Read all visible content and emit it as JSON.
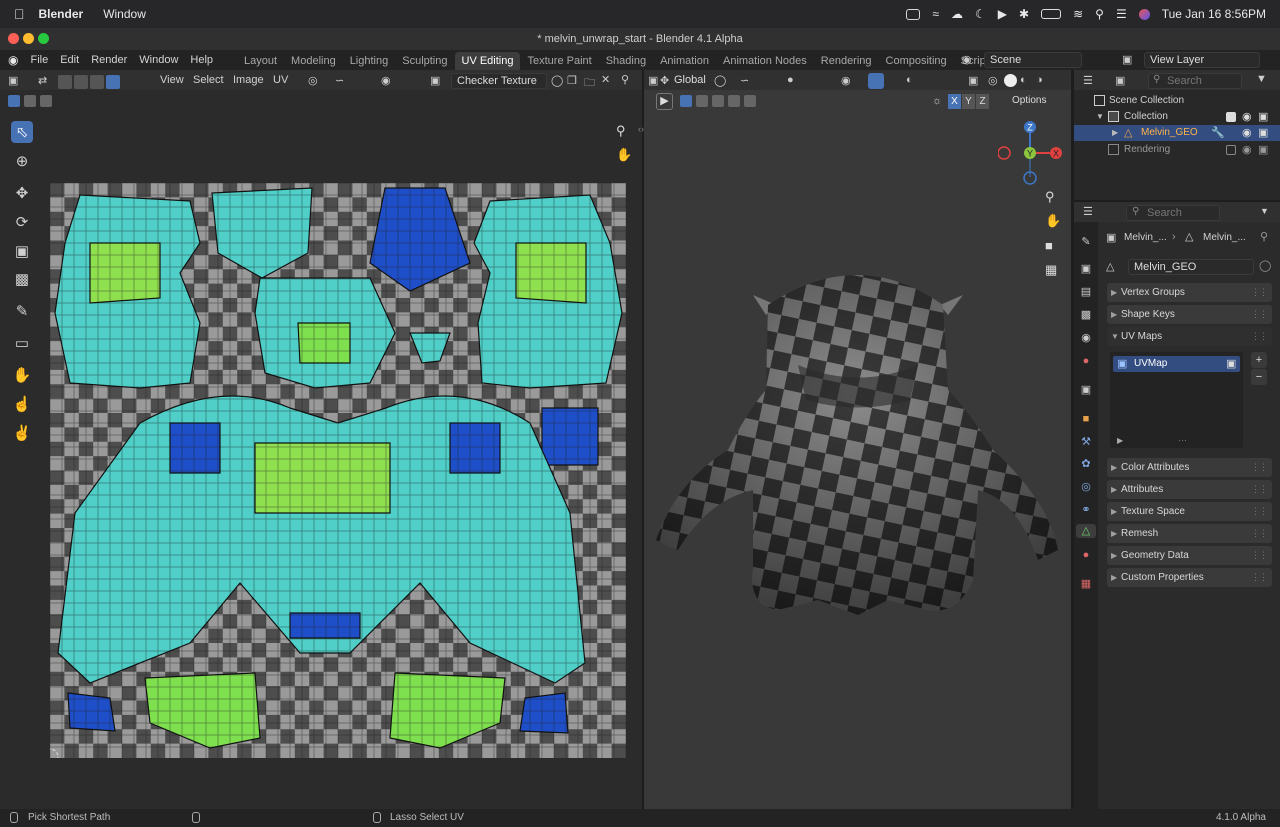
{
  "menubar": {
    "apple_icon": "apple-logo",
    "app_name": "Blender",
    "menus": [
      "Window"
    ],
    "clock": "Tue Jan 16  8:56PM"
  },
  "window": {
    "title": "* melvin_unwrap_start - Blender 4.1 Alpha"
  },
  "topbar": {
    "menus": [
      "File",
      "Edit",
      "Render",
      "Window",
      "Help"
    ],
    "workspaces": [
      "Layout",
      "Modeling",
      "Lighting",
      "Sculpting",
      "UV Editing",
      "Texture Paint",
      "Shading",
      "Animation",
      "Animation Nodes",
      "Rendering",
      "Compositing",
      "Scripting"
    ],
    "active_workspace": "UV Editing",
    "add_tab": "+",
    "scene": "Scene",
    "view_layer": "View Layer"
  },
  "uv_editor": {
    "menus": [
      "View",
      "Select",
      "Image",
      "UV"
    ],
    "image_name": "Checker Texture"
  },
  "viewport": {
    "orientation": "Global",
    "options_label": "Options",
    "axes": {
      "x": "X",
      "y": "Y",
      "z": "Z"
    },
    "gizmo": {
      "z": "Z",
      "y": "Y",
      "x": "X"
    }
  },
  "outliner": {
    "search_placeholder": "Search",
    "items": [
      {
        "label": "Scene Collection"
      },
      {
        "label": "Collection"
      },
      {
        "label": "Melvin_GEO"
      },
      {
        "label": "Rendering"
      }
    ]
  },
  "properties": {
    "search_placeholder": "Search",
    "breadcrumb": [
      "Melvin_...",
      "Melvin_..."
    ],
    "mesh_name": "Melvin_GEO",
    "panels": [
      "Vertex Groups",
      "Shape Keys",
      "UV Maps",
      "Color Attributes",
      "Attributes",
      "Texture Space",
      "Remesh",
      "Geometry Data",
      "Custom Properties"
    ],
    "uv_map_item": "UVMap",
    "list_add": "+",
    "list_remove": "−"
  },
  "statusbar": {
    "left_hint": "Pick Shortest Path",
    "middle_hint": "Lasso Select UV",
    "version": "4.1.0 Alpha"
  },
  "colors": {
    "accent": "#4772b3",
    "uv_blue": "#1f4fc8",
    "uv_cyan": "#4fcfc7",
    "uv_green": "#7fe04f",
    "gizmo_x": "#e0403f",
    "gizmo_y": "#8bc43d",
    "gizmo_z": "#3d78c8"
  }
}
